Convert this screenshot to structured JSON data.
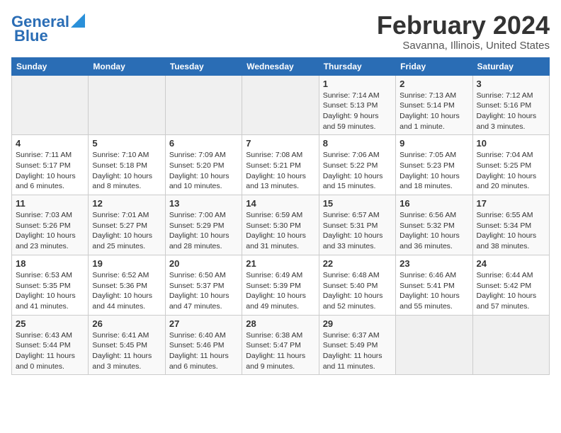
{
  "header": {
    "logo_line1": "General",
    "logo_line2": "Blue",
    "month_title": "February 2024",
    "location": "Savanna, Illinois, United States"
  },
  "days_of_week": [
    "Sunday",
    "Monday",
    "Tuesday",
    "Wednesday",
    "Thursday",
    "Friday",
    "Saturday"
  ],
  "weeks": [
    [
      {
        "day": "",
        "empty": true
      },
      {
        "day": "",
        "empty": true
      },
      {
        "day": "",
        "empty": true
      },
      {
        "day": "",
        "empty": true
      },
      {
        "day": "1",
        "sunrise": "7:14 AM",
        "sunset": "5:13 PM",
        "daylight": "9 hours and 59 minutes."
      },
      {
        "day": "2",
        "sunrise": "7:13 AM",
        "sunset": "5:14 PM",
        "daylight": "10 hours and 1 minute."
      },
      {
        "day": "3",
        "sunrise": "7:12 AM",
        "sunset": "5:16 PM",
        "daylight": "10 hours and 3 minutes."
      }
    ],
    [
      {
        "day": "4",
        "sunrise": "7:11 AM",
        "sunset": "5:17 PM",
        "daylight": "10 hours and 6 minutes."
      },
      {
        "day": "5",
        "sunrise": "7:10 AM",
        "sunset": "5:18 PM",
        "daylight": "10 hours and 8 minutes."
      },
      {
        "day": "6",
        "sunrise": "7:09 AM",
        "sunset": "5:20 PM",
        "daylight": "10 hours and 10 minutes."
      },
      {
        "day": "7",
        "sunrise": "7:08 AM",
        "sunset": "5:21 PM",
        "daylight": "10 hours and 13 minutes."
      },
      {
        "day": "8",
        "sunrise": "7:06 AM",
        "sunset": "5:22 PM",
        "daylight": "10 hours and 15 minutes."
      },
      {
        "day": "9",
        "sunrise": "7:05 AM",
        "sunset": "5:23 PM",
        "daylight": "10 hours and 18 minutes."
      },
      {
        "day": "10",
        "sunrise": "7:04 AM",
        "sunset": "5:25 PM",
        "daylight": "10 hours and 20 minutes."
      }
    ],
    [
      {
        "day": "11",
        "sunrise": "7:03 AM",
        "sunset": "5:26 PM",
        "daylight": "10 hours and 23 minutes."
      },
      {
        "day": "12",
        "sunrise": "7:01 AM",
        "sunset": "5:27 PM",
        "daylight": "10 hours and 25 minutes."
      },
      {
        "day": "13",
        "sunrise": "7:00 AM",
        "sunset": "5:29 PM",
        "daylight": "10 hours and 28 minutes."
      },
      {
        "day": "14",
        "sunrise": "6:59 AM",
        "sunset": "5:30 PM",
        "daylight": "10 hours and 31 minutes."
      },
      {
        "day": "15",
        "sunrise": "6:57 AM",
        "sunset": "5:31 PM",
        "daylight": "10 hours and 33 minutes."
      },
      {
        "day": "16",
        "sunrise": "6:56 AM",
        "sunset": "5:32 PM",
        "daylight": "10 hours and 36 minutes."
      },
      {
        "day": "17",
        "sunrise": "6:55 AM",
        "sunset": "5:34 PM",
        "daylight": "10 hours and 38 minutes."
      }
    ],
    [
      {
        "day": "18",
        "sunrise": "6:53 AM",
        "sunset": "5:35 PM",
        "daylight": "10 hours and 41 minutes."
      },
      {
        "day": "19",
        "sunrise": "6:52 AM",
        "sunset": "5:36 PM",
        "daylight": "10 hours and 44 minutes."
      },
      {
        "day": "20",
        "sunrise": "6:50 AM",
        "sunset": "5:37 PM",
        "daylight": "10 hours and 47 minutes."
      },
      {
        "day": "21",
        "sunrise": "6:49 AM",
        "sunset": "5:39 PM",
        "daylight": "10 hours and 49 minutes."
      },
      {
        "day": "22",
        "sunrise": "6:48 AM",
        "sunset": "5:40 PM",
        "daylight": "10 hours and 52 minutes."
      },
      {
        "day": "23",
        "sunrise": "6:46 AM",
        "sunset": "5:41 PM",
        "daylight": "10 hours and 55 minutes."
      },
      {
        "day": "24",
        "sunrise": "6:44 AM",
        "sunset": "5:42 PM",
        "daylight": "10 hours and 57 minutes."
      }
    ],
    [
      {
        "day": "25",
        "sunrise": "6:43 AM",
        "sunset": "5:44 PM",
        "daylight": "11 hours and 0 minutes."
      },
      {
        "day": "26",
        "sunrise": "6:41 AM",
        "sunset": "5:45 PM",
        "daylight": "11 hours and 3 minutes."
      },
      {
        "day": "27",
        "sunrise": "6:40 AM",
        "sunset": "5:46 PM",
        "daylight": "11 hours and 6 minutes."
      },
      {
        "day": "28",
        "sunrise": "6:38 AM",
        "sunset": "5:47 PM",
        "daylight": "11 hours and 9 minutes."
      },
      {
        "day": "29",
        "sunrise": "6:37 AM",
        "sunset": "5:49 PM",
        "daylight": "11 hours and 11 minutes."
      },
      {
        "day": "",
        "empty": true
      },
      {
        "day": "",
        "empty": true
      }
    ]
  ],
  "labels": {
    "sunrise_prefix": "Sunrise: ",
    "sunset_prefix": "Sunset: ",
    "daylight_prefix": "Daylight: "
  }
}
